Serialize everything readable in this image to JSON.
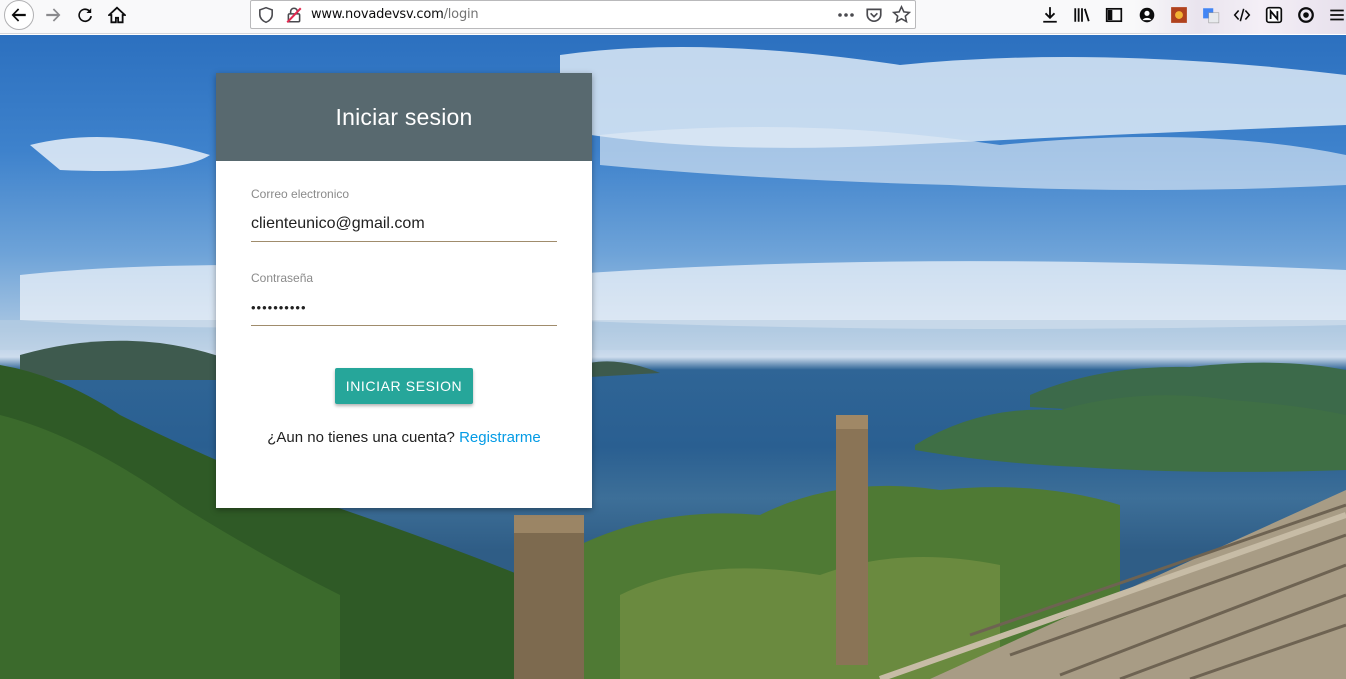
{
  "browser": {
    "url_host": "www.novadevsv.com",
    "url_path": "/login"
  },
  "login": {
    "title": "Iniciar sesion",
    "email_label": "Correo electronico",
    "email_value": "clienteunico@gmail.com",
    "password_label": "Contraseña",
    "password_value": "••••••••••",
    "submit_label": "INICIAR SESION",
    "no_account_text": "¿Aun no tienes una cuenta?",
    "register_label": "Registrarme"
  },
  "colors": {
    "header": "#58696f",
    "button": "#26a69a",
    "link": "#039be5"
  }
}
